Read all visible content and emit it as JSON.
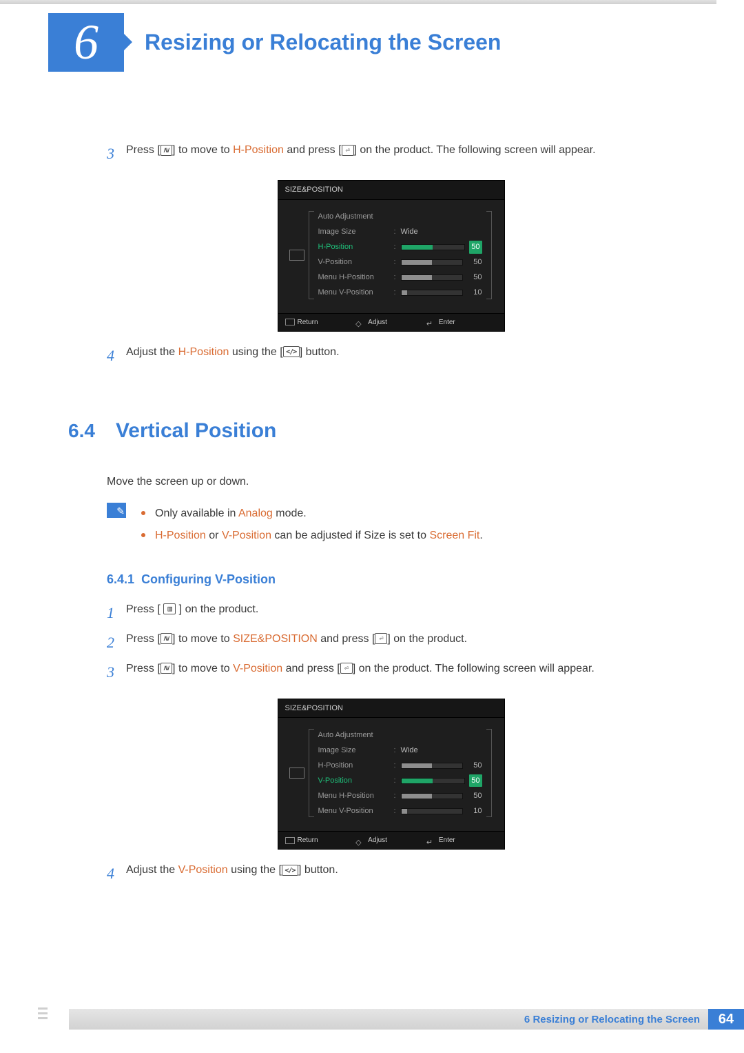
{
  "header": {
    "chapter_num": "6",
    "title": "Resizing or Relocating the Screen"
  },
  "topsteps": {
    "s3": {
      "num": "3",
      "pre": "Press [",
      "mid1": "] to move to ",
      "hl1": "H-Position",
      "mid2": " and press [",
      "post": "] on the product. The following screen will appear."
    },
    "s4": {
      "num": "4",
      "pre": "Adjust the ",
      "hl": "H-Position",
      "mid": " using the [",
      "post": "] button."
    }
  },
  "osd1": {
    "title": "SIZE&POSITION",
    "rows": [
      {
        "label": "Auto Adjustment",
        "value": "",
        "num": "",
        "sel": false,
        "bar": false
      },
      {
        "label": "Image Size",
        "value": "Wide",
        "num": "",
        "sel": false,
        "bar": false
      },
      {
        "label": "H-Position",
        "value": "",
        "num": "50",
        "sel": true,
        "bar": true,
        "fill": 50
      },
      {
        "label": "V-Position",
        "value": "",
        "num": "50",
        "sel": false,
        "bar": true,
        "fill": 50
      },
      {
        "label": "Menu H-Position",
        "value": "",
        "num": "50",
        "sel": false,
        "bar": true,
        "fill": 50
      },
      {
        "label": "Menu V-Position",
        "value": "",
        "num": "10",
        "sel": false,
        "bar": true,
        "fill": 10
      }
    ],
    "foot": {
      "return": "Return",
      "adjust": "Adjust",
      "enter": "Enter"
    }
  },
  "section": {
    "num": "6.4",
    "title": "Vertical Position"
  },
  "para1": "Move the screen up or down.",
  "notes": {
    "n1": {
      "pre": "Only available in ",
      "hl": "Analog",
      "post": " mode."
    },
    "n2": {
      "hl1": "H-Position",
      "mid": " or ",
      "hl2": "V-Position",
      "t": " can be adjusted if Size is set to ",
      "hl3": "Screen Fit",
      "post": "."
    }
  },
  "sub": {
    "num": "6.4.1",
    "title": "Configuring V-Position"
  },
  "steps2": {
    "s1": {
      "num": "1",
      "pre": "Press [ ",
      "post": " ] on the product."
    },
    "s2": {
      "num": "2",
      "pre": "Press [",
      "mid1": "] to move to ",
      "hl": "SIZE&POSITION",
      "mid2": " and press [",
      "post": "] on the product."
    },
    "s3": {
      "num": "3",
      "pre": "Press [",
      "mid1": "] to move to ",
      "hl": "V-Position",
      "mid2": " and press [",
      "post": "] on the product. The following screen will appear."
    },
    "s4": {
      "num": "4",
      "pre": "Adjust the ",
      "hl": "V-Position",
      "mid": " using the [",
      "post": "] button."
    }
  },
  "osd2": {
    "title": "SIZE&POSITION",
    "rows": [
      {
        "label": "Auto Adjustment",
        "value": "",
        "num": "",
        "sel": false,
        "bar": false
      },
      {
        "label": "Image Size",
        "value": "Wide",
        "num": "",
        "sel": false,
        "bar": false
      },
      {
        "label": "H-Position",
        "value": "",
        "num": "50",
        "sel": false,
        "bar": true,
        "fill": 50
      },
      {
        "label": "V-Position",
        "value": "",
        "num": "50",
        "sel": true,
        "bar": true,
        "fill": 50
      },
      {
        "label": "Menu H-Position",
        "value": "",
        "num": "50",
        "sel": false,
        "bar": true,
        "fill": 50
      },
      {
        "label": "Menu V-Position",
        "value": "",
        "num": "10",
        "sel": false,
        "bar": true,
        "fill": 10
      }
    ],
    "foot": {
      "return": "Return",
      "adjust": "Adjust",
      "enter": "Enter"
    }
  },
  "footer": {
    "text_num": "6",
    "text": "Resizing or Relocating the Screen",
    "page": "64"
  }
}
